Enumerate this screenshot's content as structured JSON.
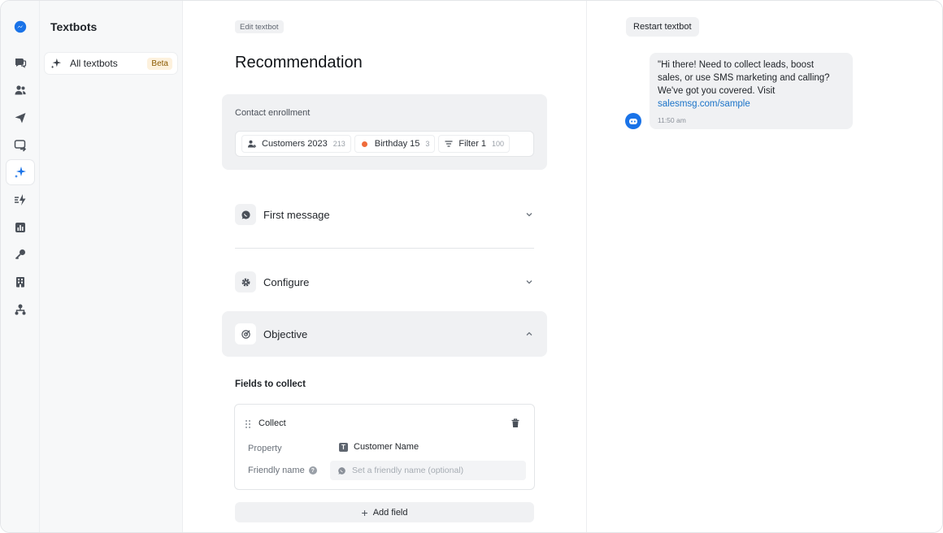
{
  "colors": {
    "brand": "#1a73e8",
    "accent_link": "#1a73c8",
    "dot_orange": "#ef6b3b",
    "panel_gray": "#f0f1f3"
  },
  "rail": {
    "icons": [
      "messenger-logo-icon",
      "chat-bubbles-icon",
      "contacts-icon",
      "send-icon",
      "message-forward-icon",
      "sparkle-icon",
      "lightning-icon",
      "bar-chart-icon",
      "key-icon",
      "building-icon",
      "org-tree-icon"
    ]
  },
  "sidebar": {
    "title": "Textbots",
    "items": [
      {
        "label": "All textbots",
        "badge": "Beta"
      }
    ]
  },
  "main": {
    "edit_tag": "Edit textbot",
    "title": "Recommendation",
    "enrollment": {
      "label": "Contact enrollment",
      "chips": [
        {
          "label": "Customers 2023",
          "count": "213",
          "icon": "contact-group-icon"
        },
        {
          "label": "Birthday 15",
          "count": "3",
          "icon": "orange-dot"
        },
        {
          "label": "Filter 1",
          "count": "100",
          "icon": "filter-icon"
        }
      ]
    },
    "sections": [
      {
        "label": "First message",
        "icon": "whatsapp-icon"
      },
      {
        "label": "Configure",
        "icon": "gear-icon"
      },
      {
        "label": "Objective",
        "icon": "target-icon"
      }
    ],
    "fields_label": "Fields to collect",
    "collect": {
      "title": "Collect",
      "property_label": "Property",
      "property_value": "Customer Name",
      "friendly_label": "Friendly name",
      "friendly_placeholder": "Set a friendly name (optional)"
    },
    "add_field": "Add field"
  },
  "preview": {
    "restart": "Restart textbot",
    "message_lines": [
      "\"Hi there! Need to collect leads, boost",
      "sales, or use SMS marketing and calling?",
      "We've got you covered. Visit"
    ],
    "message_link": "salesmsg.com/sample",
    "time": "11:50 am"
  }
}
